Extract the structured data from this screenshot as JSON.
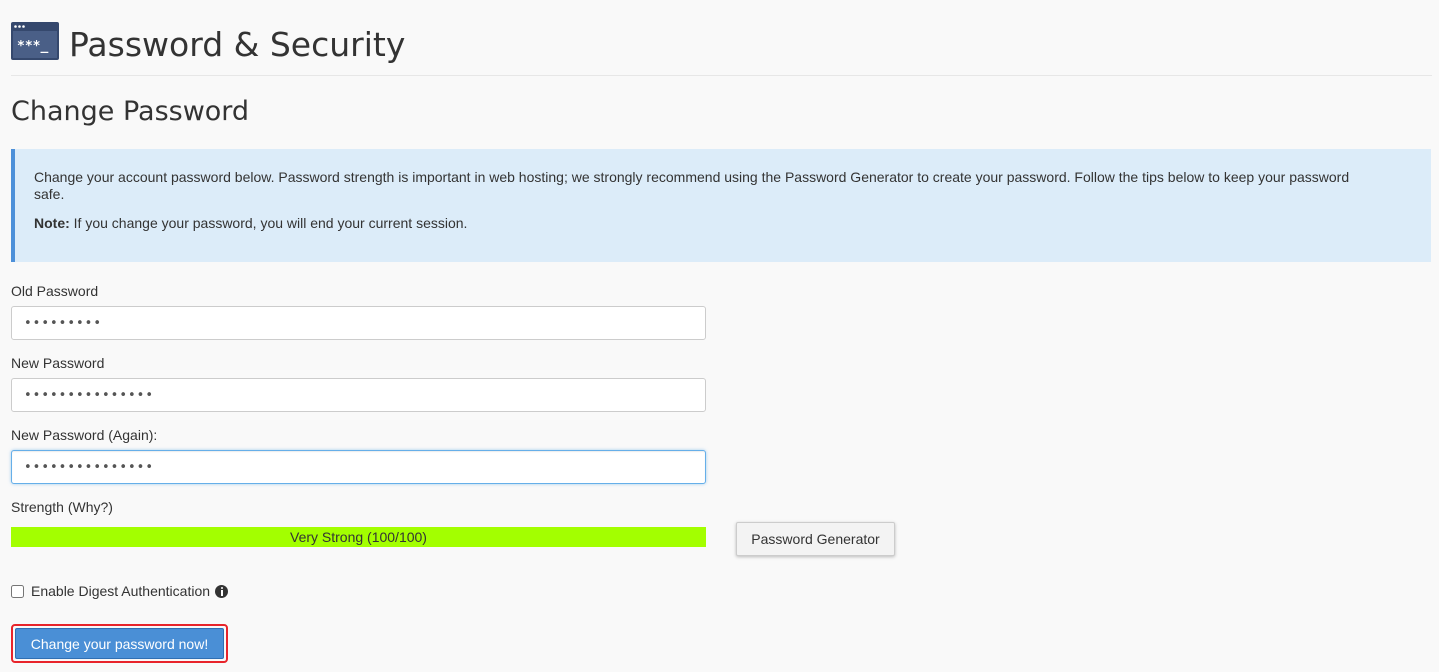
{
  "header": {
    "app_icon": "password-terminal-icon",
    "icon_text": "***_",
    "title": "Password & Security"
  },
  "section": {
    "title": "Change Password"
  },
  "callout": {
    "text": "Change your account password below. Password strength is important in web hosting; we strongly recommend using the Password Generator to create your password. Follow the tips below to keep your password safe.",
    "note_label": "Note:",
    "note_text": " If you change your password, you will end your current session."
  },
  "form": {
    "old_password": {
      "label": "Old Password",
      "value": "•••••••••"
    },
    "new_password": {
      "label": "New Password",
      "value": "•••••••••••••••"
    },
    "new_password_again": {
      "label": "New Password (Again):",
      "value": "•••••••••••••••"
    },
    "strength": {
      "label": "Strength (Why?)",
      "text": "Very Strong (100/100)",
      "score": 100,
      "max": 100
    },
    "generator_button": "Password Generator",
    "digest": {
      "label": "Enable Digest Authentication",
      "checked": false,
      "icon": "info-circle-icon"
    },
    "submit_label": "Change your password now!"
  },
  "colors": {
    "page_bg": "#f9f9f9",
    "callout_bg": "#dcecf9",
    "callout_border": "#4d90d9",
    "strength_fill": "#a3ff00",
    "primary_button": "#4a8fd6",
    "highlight_outline": "#e8242b",
    "icon_dark": "#35486d"
  }
}
